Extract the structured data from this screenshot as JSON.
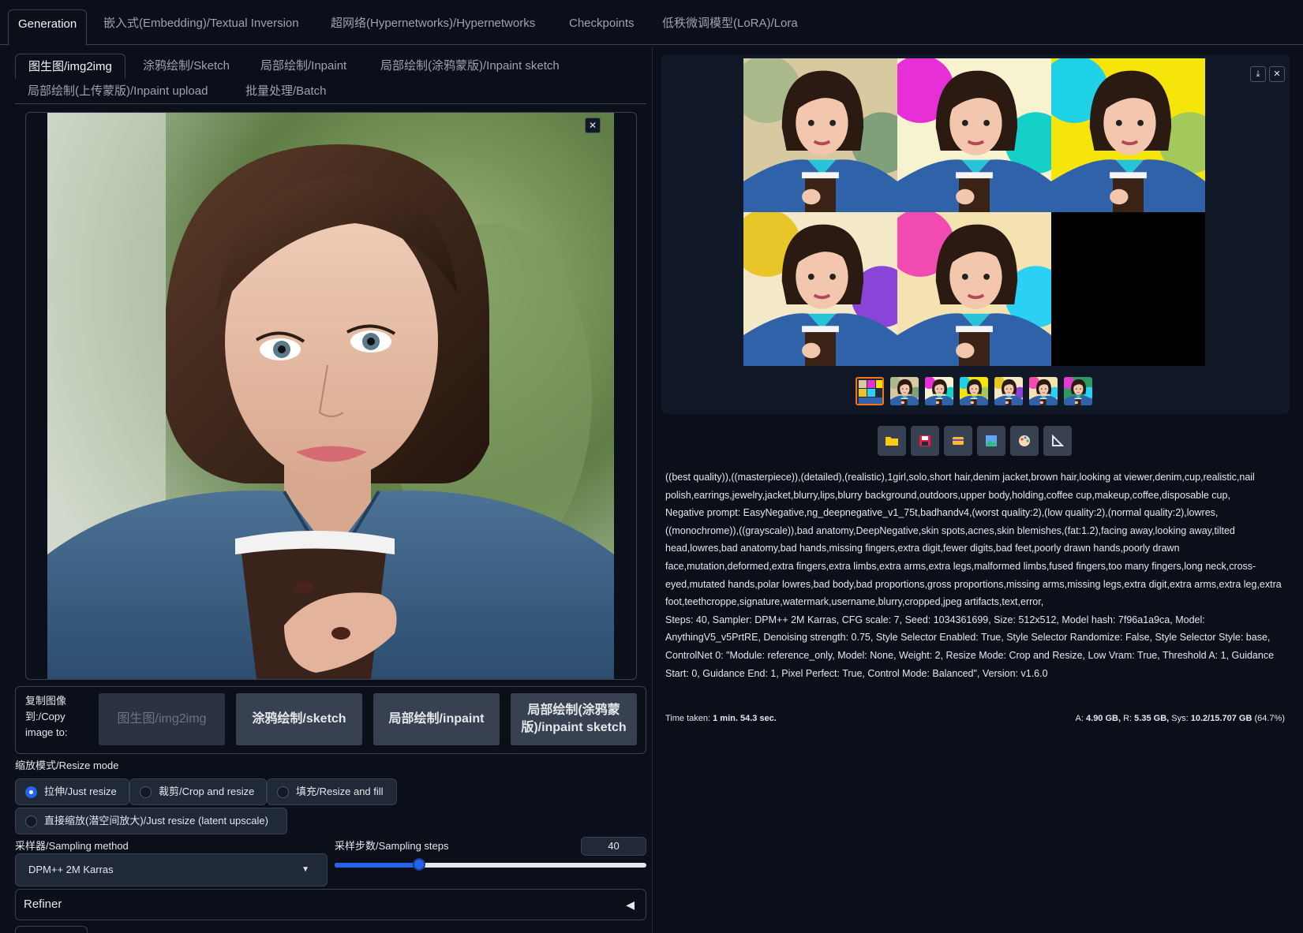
{
  "top_tabs": [
    "Generation",
    "嵌入式(Embedding)/Textual Inversion",
    "超网络(Hypernetworks)/Hypernetworks",
    "Checkpoints",
    "低秩微调模型(LoRA)/Lora"
  ],
  "sub_tabs_row1": [
    "图生图/img2img",
    "涂鸦绘制/Sketch",
    "局部绘制/Inpaint",
    "局部绘制(涂鸦蒙版)/Inpaint sketch"
  ],
  "sub_tabs_row2": [
    "局部绘制(上传蒙版)/Inpaint upload",
    "批量处理/Batch"
  ],
  "copy": {
    "label": "复制图像到:/Copy image to:",
    "buttons": [
      "图生图/img2img",
      "涂鸦绘制/sketch",
      "局部绘制/inpaint",
      "局部绘制(涂鸦蒙版)/inpaint sketch"
    ]
  },
  "resize": {
    "label": "缩放模式/Resize mode",
    "options": [
      "拉伸/Just resize",
      "裁剪/Crop and resize",
      "填充/Resize and fill",
      "直接缩放(潜空间放大)/Just resize (latent upscale)"
    ],
    "selected": 0
  },
  "sampler": {
    "label": "采样器/Sampling method",
    "value": "DPM++ 2M Karras"
  },
  "steps": {
    "label": "采样步数/Sampling steps",
    "value": "40",
    "fraction": 0.27
  },
  "refiner": {
    "label": "Refiner"
  },
  "gallery": {
    "tools": [
      "folder-icon",
      "save-icon",
      "zip-icon",
      "image-icon",
      "palette-icon",
      "ruler-icon"
    ]
  },
  "info": {
    "prompt": "((best quality)),((masterpiece)),(detailed),(realistic),1girl,solo,short hair,denim jacket,brown hair,looking at viewer,denim,cup,realistic,nail polish,earrings,jewelry,jacket,blurry,lips,blurry background,outdoors,upper body,holding,coffee cup,makeup,coffee,disposable cup,",
    "negative": "Negative prompt: EasyNegative,ng_deepnegative_v1_75t,badhandv4,(worst quality:2),(low quality:2),(normal quality:2),lowres,((monochrome)),((grayscale)),bad anatomy,DeepNegative,skin spots,acnes,skin blemishes,(fat:1.2),facing away,looking away,tilted head,lowres,bad anatomy,bad hands,missing fingers,extra digit,fewer digits,bad feet,poorly drawn hands,poorly drawn face,mutation,deformed,extra fingers,extra limbs,extra arms,extra legs,malformed limbs,fused fingers,too many fingers,long neck,cross-eyed,mutated hands,polar lowres,bad body,bad proportions,gross proportions,missing arms,missing legs,extra digit,extra arms,extra leg,extra foot,teethcroppe,signature,watermark,username,blurry,cropped,jpeg artifacts,text,error,",
    "params": "Steps: 40, Sampler: DPM++ 2M Karras, CFG scale: 7, Seed: 1034361699, Size: 512x512, Model hash: 7f96a1a9ca, Model: AnythingV5_v5PrtRE, Denoising strength: 0.75, Style Selector Enabled: True, Style Selector Randomize: False, Style Selector Style: base, ControlNet 0: \"Module: reference_only, Model: None, Weight: 2, Resize Mode: Crop and Resize, Low Vram: True, Threshold A: 1, Guidance Start: 0, Guidance End: 1, Pixel Perfect: True, Control Mode: Balanced\", Version: v1.6.0",
    "time_label": "Time taken:",
    "time_value": "1 min. 54.3 sec.",
    "vram_a_label": "A:",
    "vram_a": "4.90 GB,",
    "vram_r_label": "R:",
    "vram_r": "5.35 GB,",
    "vram_sys_label": "Sys:",
    "vram_sys": "10.2/15.707 GB",
    "vram_pct": "(64.7%)"
  },
  "colors": {
    "accent": "#2563eb",
    "selected_thumb": "#f97316",
    "bg": "#0b0f19",
    "panel": "#111827"
  }
}
